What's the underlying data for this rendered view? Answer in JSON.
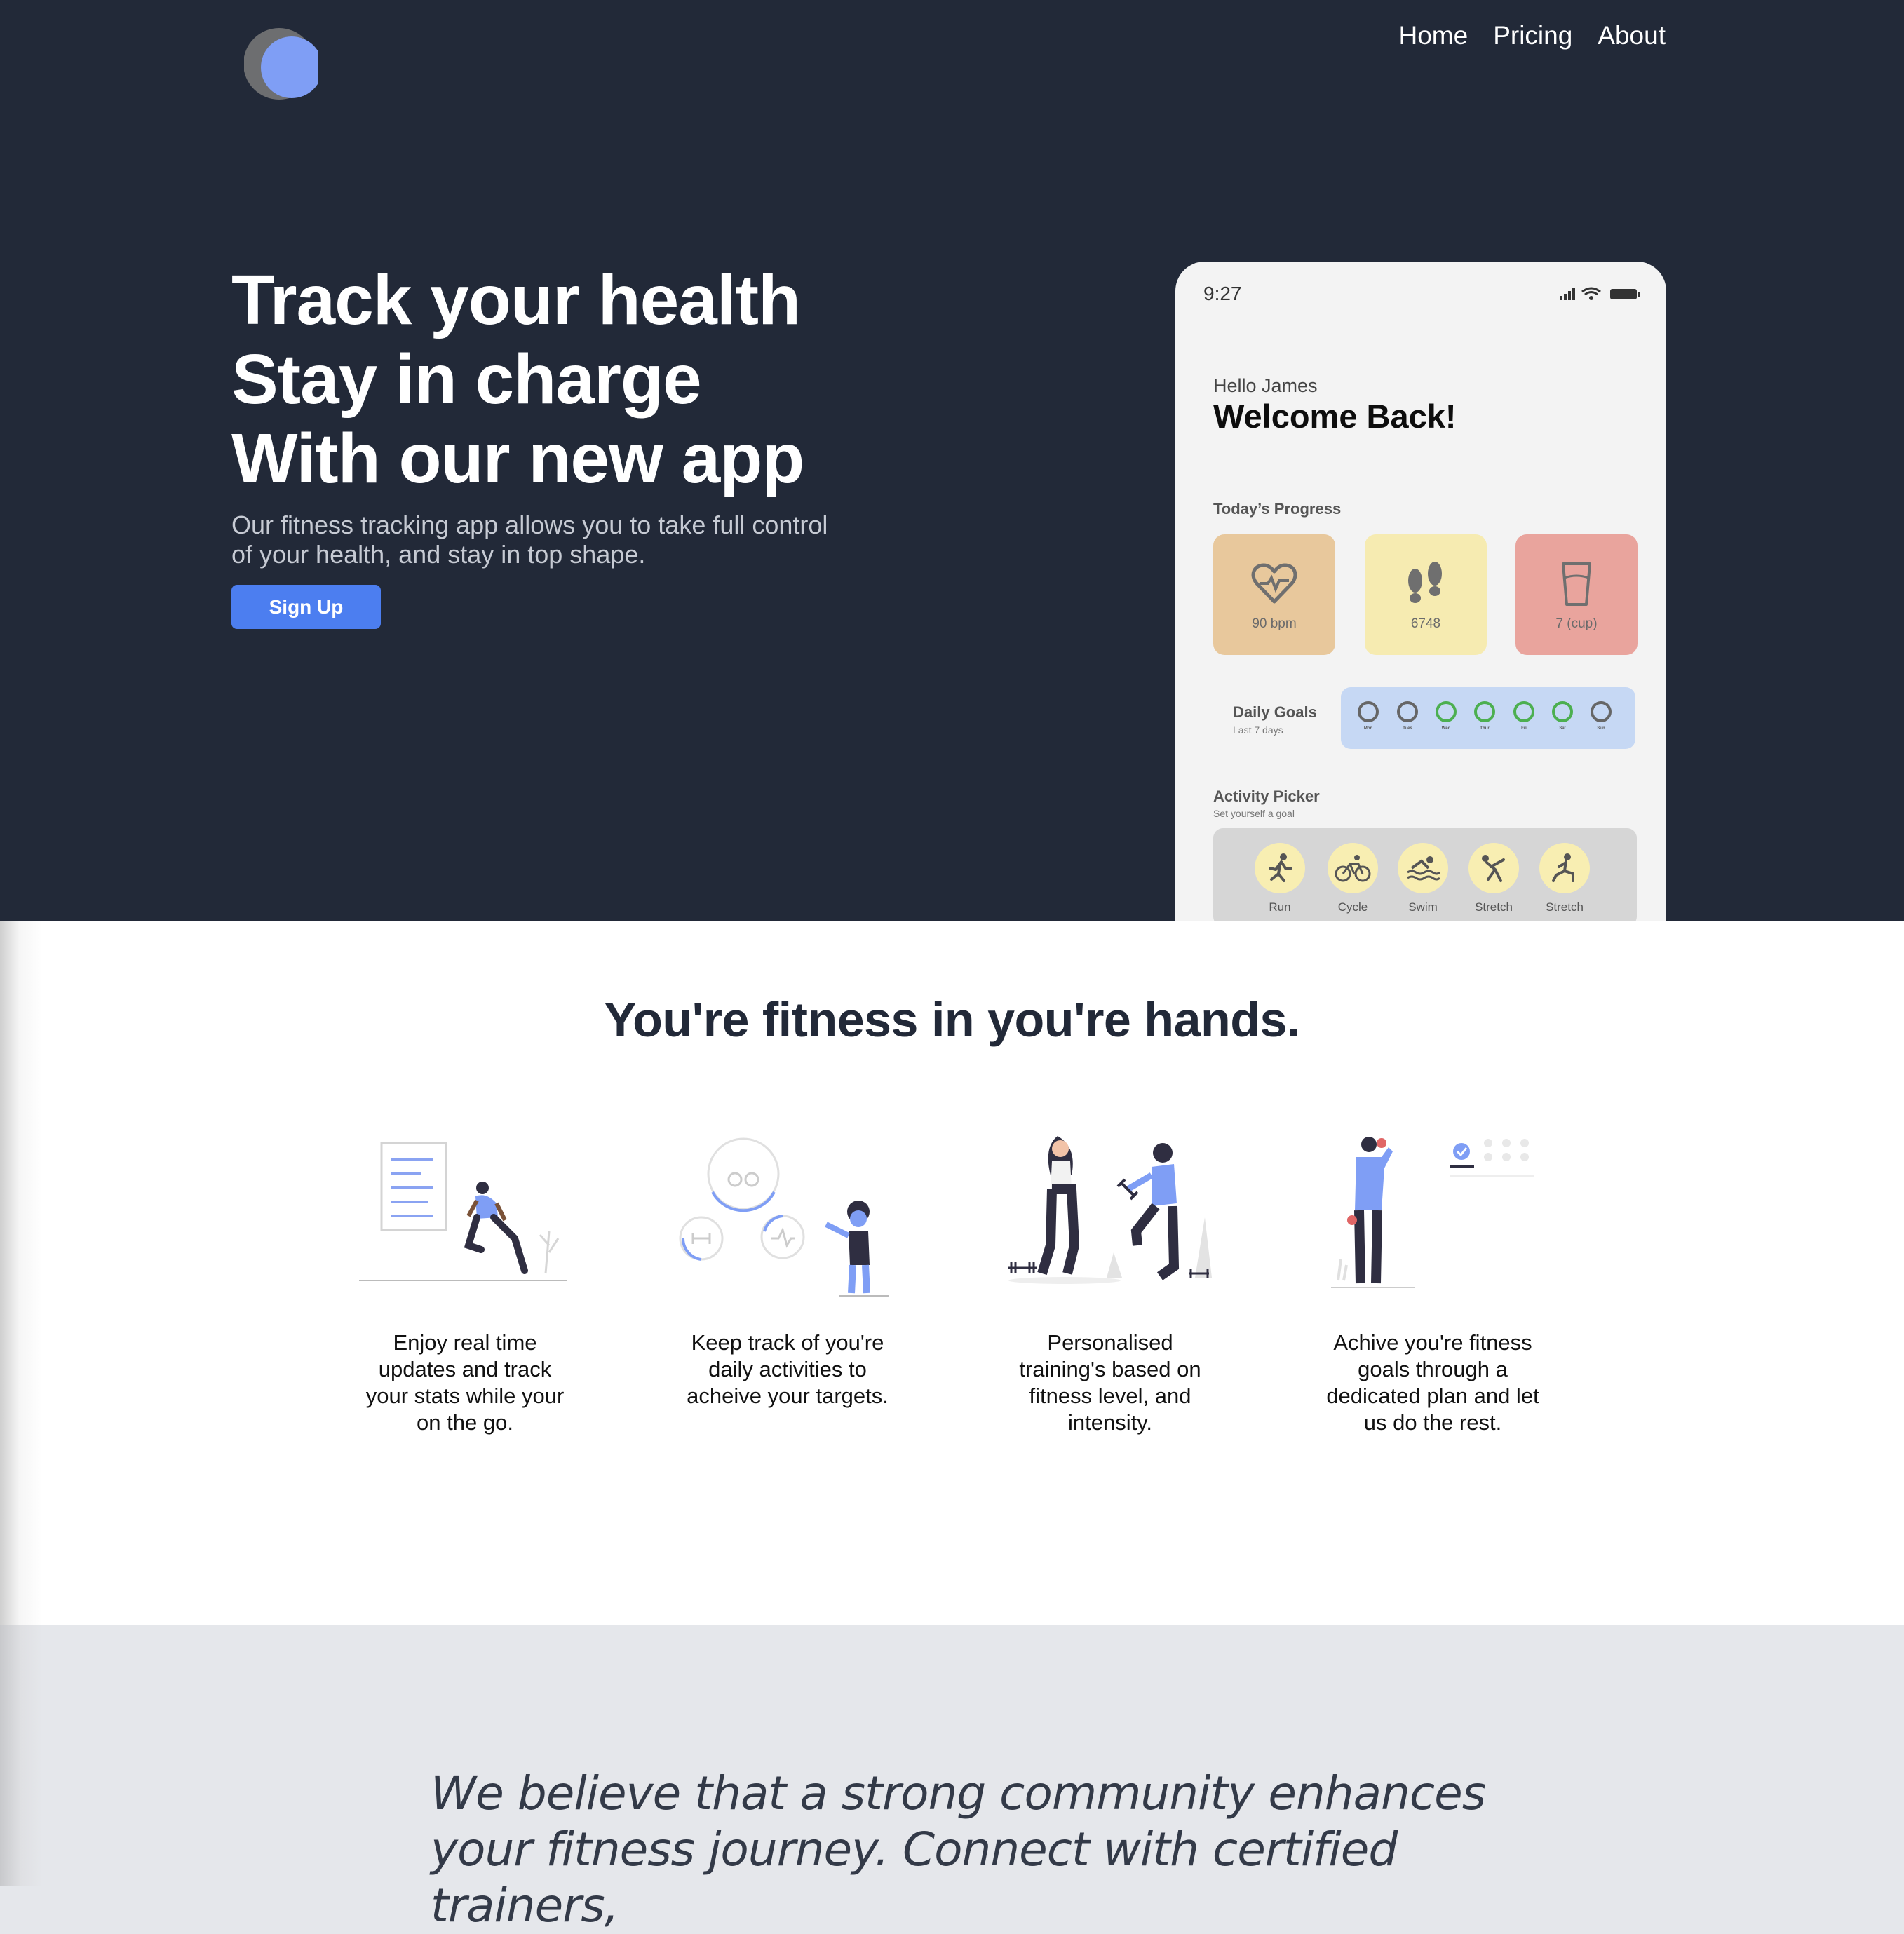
{
  "nav": {
    "items": [
      "Home",
      "Pricing",
      "About"
    ]
  },
  "hero": {
    "lines": [
      "Track your health",
      "Stay in charge",
      "With our new app"
    ],
    "subtitle": "Our fitness tracking app allows you to take full control of your health, and stay in top shape.",
    "cta": "Sign Up",
    "accent": "#4c7ef0",
    "background": "#222938"
  },
  "phone": {
    "time": "9:27",
    "greeting": "Hello James",
    "welcome": "Welcome Back!",
    "progress_label": "Today’s Progress",
    "cards": [
      {
        "value": "90 bpm",
        "icon": "heart-rate-icon",
        "color": "#e8c89c"
      },
      {
        "value": "6748",
        "icon": "footprints-icon",
        "color": "#f6ebb1"
      },
      {
        "value": "7 (cup)",
        "icon": "water-cup-icon",
        "color": "#e9a49d"
      }
    ],
    "daily_goals": {
      "title": "Daily Goals",
      "subtitle": "Last 7 days",
      "days": [
        "Mon",
        "Tues",
        "Wed",
        "Thur",
        "Fri",
        "Sat",
        "Sun"
      ]
    },
    "activity": {
      "title": "Activity Picker",
      "subtitle": "Set yourself a goal",
      "items": [
        {
          "label": "Run",
          "icon": "run-icon"
        },
        {
          "label": "Cycle",
          "icon": "cycle-icon"
        },
        {
          "label": "Swim",
          "icon": "swim-icon"
        },
        {
          "label": "Stretch",
          "icon": "stretch-icon"
        },
        {
          "label": "Stretch",
          "icon": "lunge-icon"
        }
      ]
    }
  },
  "features": {
    "heading": "You're fitness in you're hands.",
    "items": [
      {
        "text": "Enjoy real time updates and track your stats while your on the go."
      },
      {
        "text": "Keep track of you're daily activities to acheive your targets."
      },
      {
        "text": "Personalised training's based on fitness level, and intensity."
      },
      {
        "text": "Achive you're fitness goals through a dedicated plan and let us do the rest."
      }
    ]
  },
  "community": {
    "quote": "We believe that a strong community enhances your fitness journey. Connect with certified trainers,"
  }
}
